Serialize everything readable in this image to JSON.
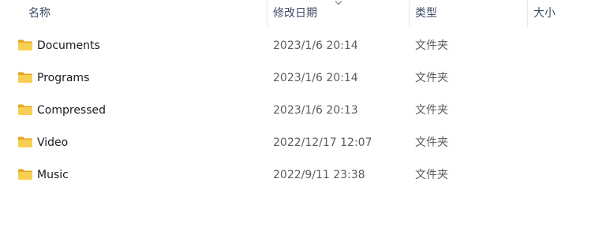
{
  "columns": {
    "name": "名称",
    "modified": "修改日期",
    "type": "类型",
    "size": "大小"
  },
  "sort": {
    "column": "modified",
    "direction": "descending"
  },
  "rows": [
    {
      "icon": "folder-icon",
      "name": "Documents",
      "modified": "2023/1/6 20:14",
      "type": "文件夹",
      "size": ""
    },
    {
      "icon": "folder-icon",
      "name": "Programs",
      "modified": "2023/1/6 20:14",
      "type": "文件夹",
      "size": ""
    },
    {
      "icon": "folder-icon",
      "name": "Compressed",
      "modified": "2023/1/6 20:13",
      "type": "文件夹",
      "size": ""
    },
    {
      "icon": "folder-icon",
      "name": "Video",
      "modified": "2022/12/17 12:07",
      "type": "文件夹",
      "size": ""
    },
    {
      "icon": "folder-icon",
      "name": "Music",
      "modified": "2022/9/11 23:38",
      "type": "文件夹",
      "size": ""
    }
  ],
  "colors": {
    "header_text": "#3c4a66",
    "folder_front": "#f8cf55",
    "folder_back": "#e5a623"
  }
}
